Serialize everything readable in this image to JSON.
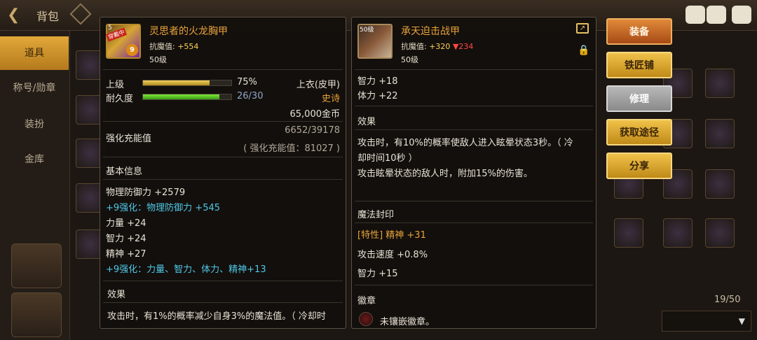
{
  "topbar": {
    "back_icon": "back-arrow-icon",
    "title": "背包"
  },
  "nav": {
    "items": [
      {
        "label": "道具",
        "active": true
      },
      {
        "label": "称号/勋章"
      },
      {
        "label": "装扮"
      },
      {
        "label": "金库"
      }
    ]
  },
  "panel_left": {
    "item_name": "灵思者的火龙胸甲",
    "icon_level": "5",
    "icon_badge": "穿戴中",
    "icon_plus": "9",
    "resist_label": "抗魔值:",
    "resist_value": "+554",
    "level": "50级",
    "upgrade_label": "上级",
    "upgrade_pct_text": "75%",
    "upgrade_fraction": 0.75,
    "slot_type": "上衣(皮甲)",
    "durability_label": "耐久度",
    "durability_text": "26/30",
    "durability_fraction": 0.8667,
    "rarity": "史诗",
    "price": "65,000金币",
    "charge_label": "强化充能值",
    "charge_value": "6652/39178",
    "charge_sub": "( 强化充能值：81027 )",
    "basic_header": "基本信息",
    "stats": [
      {
        "text": "物理防御力 +2579",
        "style": "normal"
      },
      {
        "text": "+9强化：物理防御力 +545",
        "style": "cyan"
      },
      {
        "text": "力量 +24",
        "style": "normal"
      },
      {
        "text": "智力 +24",
        "style": "normal"
      },
      {
        "text": "精神 +27",
        "style": "normal"
      },
      {
        "text": "+9强化：力量、智力、体力、精神+13",
        "style": "cyan"
      }
    ],
    "effect_header": "效果",
    "effect_text": "攻击时，有1%的概率减少自身3%的魔法值。（ 冷却时"
  },
  "panel_right": {
    "item_name": "承天迫击战甲",
    "icon_level": "50级",
    "resist_label": "抗魔值:",
    "resist_value": "+320",
    "resist_down": "▼234",
    "level": "50级",
    "stats_top": [
      {
        "text": "智力 +18"
      },
      {
        "text": "体力 +22"
      }
    ],
    "effect_header": "效果",
    "effect_lines": [
      "攻击时，有10%的概率使敌人进入眩晕状态3秒。（ 冷",
      "却时间10秒 ）",
      "攻击眩晕状态的敌人时，附加15%的伤害。"
    ],
    "seal_header": "魔法封印",
    "seal_lines": [
      {
        "text": "[特性] 精神 +31",
        "style": "gold"
      },
      {
        "text": "攻击速度 +0.8%",
        "style": "normal"
      },
      {
        "text": "智力 +15",
        "style": "normal"
      }
    ],
    "emblem_header": "徽章",
    "emblem_text": "未镶嵌徽章。"
  },
  "actions": [
    {
      "label": "装备",
      "style": "orange"
    },
    {
      "label": "铁匠铺",
      "style": "gold"
    },
    {
      "label": "修理",
      "style": "grey"
    },
    {
      "label": "获取途径",
      "style": "gold"
    },
    {
      "label": "分享",
      "style": "gold"
    }
  ],
  "bag": {
    "count": "19/50"
  },
  "colors": {
    "rarity_epic": "#e8a33a",
    "enhance_cyan": "#4fc8e8",
    "resist_down": "#ff4848"
  }
}
